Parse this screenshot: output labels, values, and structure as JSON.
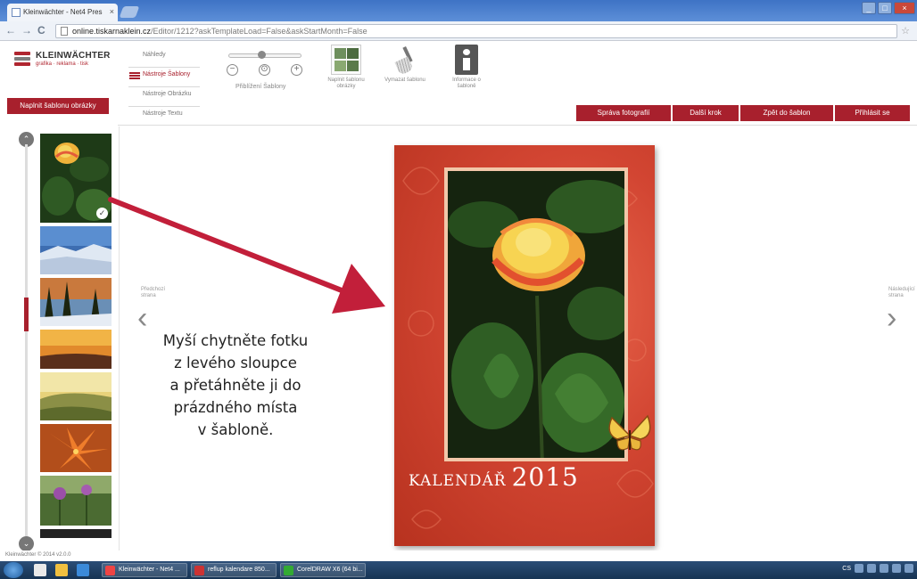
{
  "browser": {
    "tab_title": "Kleinwächter - Net4 Pres",
    "tab_close": "×",
    "url_prefix": "online.tiskarnaklein.cz",
    "url_rest": "/Editor/1212?askTemplateLoad=False&askStartMonth=False",
    "back": "←",
    "forward": "→",
    "reload": "C",
    "star": "☆"
  },
  "logo": {
    "name": "KLEINWÄCHTER",
    "tagline": "grafika · reklama · tisk"
  },
  "sidebar_button": "Naplnit šablonu obrázky",
  "menu": {
    "items": [
      {
        "label": "Náhledy",
        "active": false
      },
      {
        "label": "Nástroje Šablony",
        "active": true
      },
      {
        "label": "Nástroje Obrázku",
        "active": false
      },
      {
        "label": "Nástroje Textu",
        "active": false
      }
    ]
  },
  "zoom": {
    "label": "Přiblížení Šablony",
    "minus": "−",
    "plus": "+",
    "reset": "⊙",
    "level": 0.45
  },
  "tools": {
    "fill": "Naplnit šablonu obrázky",
    "clear": "Vymazat šablonu",
    "info": "Informace o šabloně"
  },
  "actions": [
    {
      "label": "Správa fotografií"
    },
    {
      "label": "Další krok"
    },
    {
      "label": "Zpět do šablon"
    },
    {
      "label": "Přihlásit se"
    }
  ],
  "pager": {
    "prev_label": "Předchozí strana",
    "next_label": "Následující strana",
    "prev_glyph": "‹",
    "next_glyph": "›"
  },
  "instruction": "Myší chytněte fotku\nz levého sloupce\na přetáhněte ji do\nprázdného místa\nv šabloně.",
  "calendar": {
    "label": "KALENDÁŘ",
    "year": "2015"
  },
  "scroll": {
    "up": "⌃",
    "down": "⌄"
  },
  "footer": "Kleinwächter © 2014 v2.0.0",
  "taskbar": {
    "tasks": [
      {
        "label": "Kleinwächter - Net4 ..."
      },
      {
        "label": "reflup kalendare 850..."
      },
      {
        "label": "CorelDRAW X6 (64 bi..."
      }
    ],
    "lang": "CS"
  },
  "colors": {
    "accent": "#a8202d",
    "calendar_bg": "#d24532",
    "taskbar": "#1e3f66"
  }
}
